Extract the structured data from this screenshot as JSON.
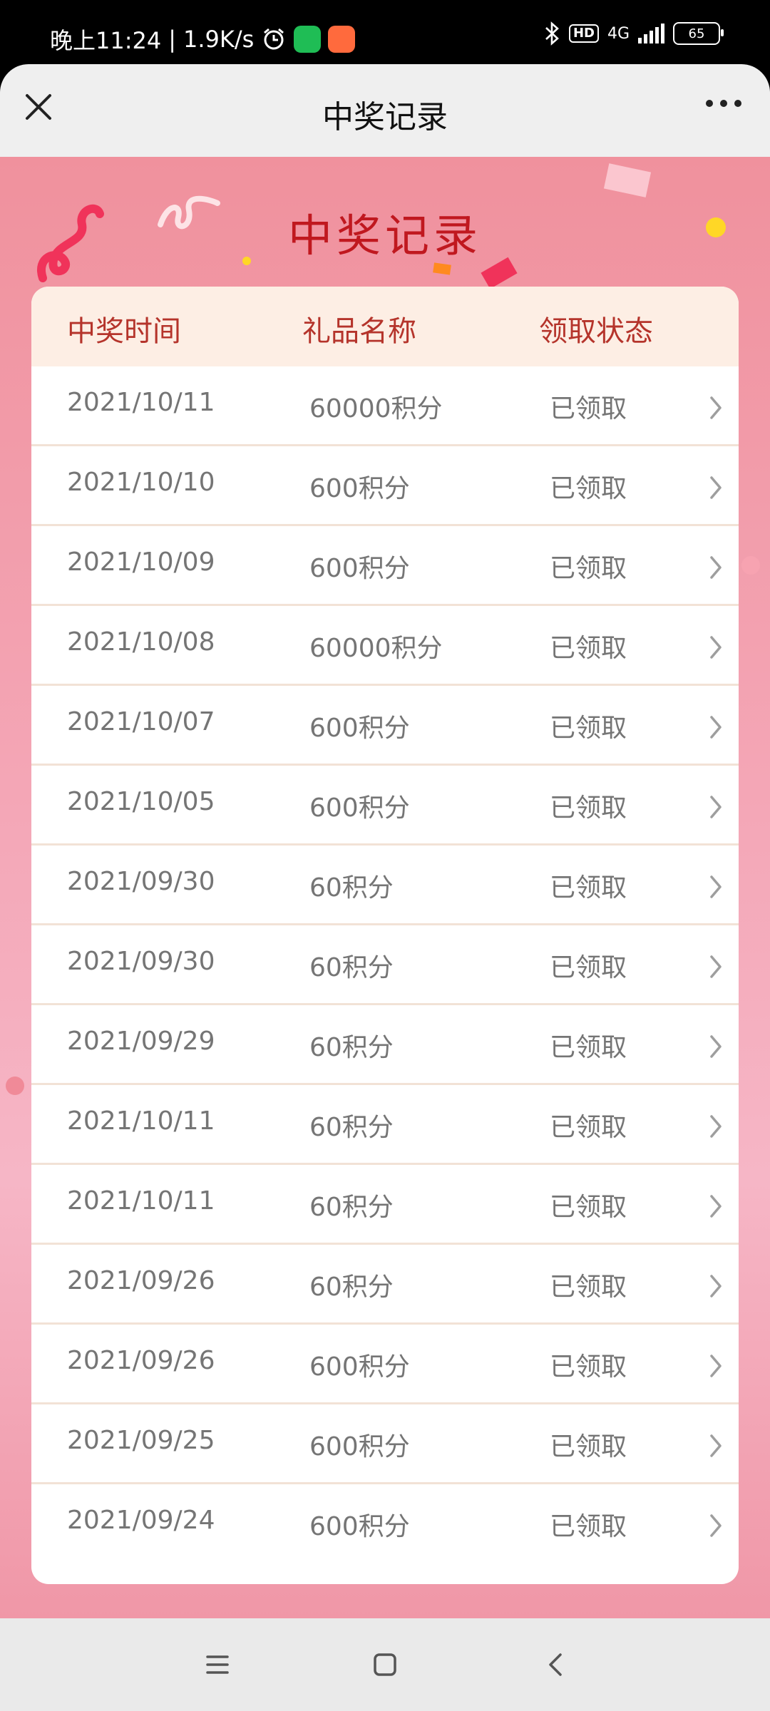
{
  "status_bar": {
    "time": "晚上11:24",
    "speed": "1.9K/s",
    "network": "4G",
    "hd": "HD",
    "battery": "65"
  },
  "nav": {
    "title": "中奖记录"
  },
  "page": {
    "title": "中奖记录"
  },
  "table": {
    "headers": [
      "中奖时间",
      "礼品名称",
      "领取状态"
    ],
    "rows": [
      {
        "date": "2021/10/11",
        "gift": "60000积分",
        "status": "已领取"
      },
      {
        "date": "2021/10/10",
        "gift": "600积分",
        "status": "已领取"
      },
      {
        "date": "2021/10/09",
        "gift": "600积分",
        "status": "已领取"
      },
      {
        "date": "2021/10/08",
        "gift": "60000积分",
        "status": "已领取"
      },
      {
        "date": "2021/10/07",
        "gift": "600积分",
        "status": "已领取"
      },
      {
        "date": "2021/10/05",
        "gift": "600积分",
        "status": "已领取"
      },
      {
        "date": "2021/09/30",
        "gift": "60积分",
        "status": "已领取"
      },
      {
        "date": "2021/09/30",
        "gift": "60积分",
        "status": "已领取"
      },
      {
        "date": "2021/09/29",
        "gift": "60积分",
        "status": "已领取"
      },
      {
        "date": "2021/10/11",
        "gift": "60积分",
        "status": "已领取"
      },
      {
        "date": "2021/10/11",
        "gift": "60积分",
        "status": "已领取"
      },
      {
        "date": "2021/09/26",
        "gift": "60积分",
        "status": "已领取"
      },
      {
        "date": "2021/09/26",
        "gift": "600积分",
        "status": "已领取"
      },
      {
        "date": "2021/09/25",
        "gift": "600积分",
        "status": "已领取"
      },
      {
        "date": "2021/09/24",
        "gift": "600积分",
        "status": "已领取"
      }
    ]
  },
  "icons": {
    "nav_close": "close-icon",
    "nav_more": "more-icon",
    "row_chevron": "chevron-right-icon",
    "bottom_menu": "menu-icon",
    "bottom_home": "home-icon",
    "bottom_back": "back-icon"
  },
  "colors": {
    "title_red": "#c0181f",
    "header_text": "#b5342b",
    "header_bg": "#fdeee4"
  }
}
